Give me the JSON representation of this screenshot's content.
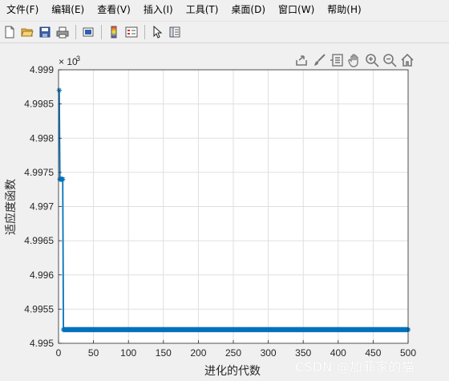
{
  "menu": [
    "文件(F)",
    "编辑(E)",
    "查看(V)",
    "插入(I)",
    "工具(T)",
    "桌面(D)",
    "窗口(W)",
    "帮助(H)"
  ],
  "toolbar_icons": [
    "new-file-icon",
    "open-folder-icon",
    "save-icon",
    "print-icon",
    "link-figure-icon",
    "colorbar-icon",
    "legend-icon",
    "pointer-icon",
    "property-editor-icon"
  ],
  "axes_toolbar_icons": [
    "export-icon",
    "brush-icon",
    "datatip-icon",
    "pan-icon",
    "zoom-in-icon",
    "zoom-out-icon",
    "home-icon"
  ],
  "watermark": "CSDN @加菲家的猫",
  "colors": {
    "line": "#0072BD",
    "grid": "#dfdfdf",
    "axes_bg": "#ffffff",
    "figure_bg": "#f0f0f0"
  },
  "chart_data": {
    "type": "line",
    "title": "",
    "xlabel": "进化的代数",
    "ylabel": "适应度函数",
    "xlim": [
      0,
      500
    ],
    "ylim": [
      0.004995,
      0.004999
    ],
    "exponent_label": "× 10",
    "exponent_power": "-3",
    "xticks": [
      0,
      50,
      100,
      150,
      200,
      250,
      300,
      350,
      400,
      450,
      500
    ],
    "xtick_labels": [
      "0",
      "50",
      "100",
      "150",
      "200",
      "250",
      "300",
      "350",
      "400",
      "450",
      "500"
    ],
    "yticks": [
      0.004995,
      0.0049955,
      0.004996,
      0.0049965,
      0.004997,
      0.0049975,
      0.004998,
      0.0049985,
      0.004999
    ],
    "ytick_labels": [
      "4.995",
      "4.9955",
      "4.996",
      "4.9965",
      "4.997",
      "4.9975",
      "4.998",
      "4.9985",
      "4.999"
    ],
    "grid": true,
    "marker": "*",
    "series": [
      {
        "x": [
          1,
          2,
          3,
          4,
          5,
          6,
          7,
          8,
          9,
          10,
          20,
          50,
          100,
          150,
          200,
          250,
          300,
          350,
          400,
          450,
          500
        ],
        "y": [
          0.0049987,
          0.0049974,
          0.0049974,
          0.0049974,
          0.0049974,
          0.0049974,
          0.0049952,
          0.0049952,
          0.0049952,
          0.0049952,
          0.0049952,
          0.0049952,
          0.0049952,
          0.0049952,
          0.0049952,
          0.0049952,
          0.0049952,
          0.0049952,
          0.0049952,
          0.0049952,
          0.0049952
        ]
      }
    ]
  }
}
